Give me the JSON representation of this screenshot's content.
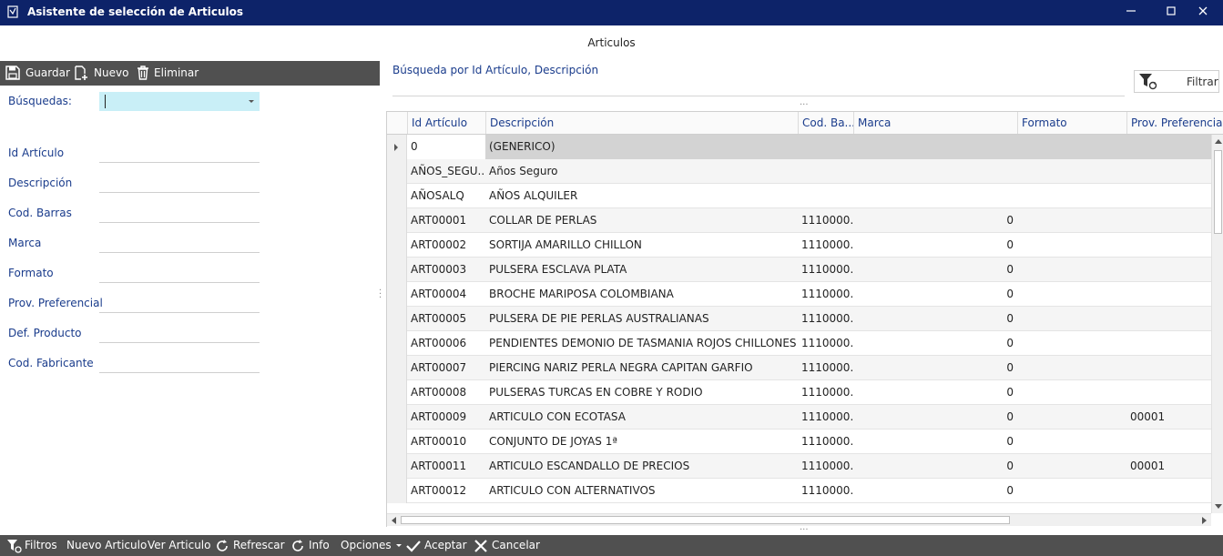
{
  "window": {
    "title": "Asistente de selección de Articulos",
    "app_icon": "app-icon",
    "controls": [
      "minimize-icon",
      "maximize-icon",
      "close-icon"
    ]
  },
  "header": {
    "label": "Articulos"
  },
  "left_toolbar": {
    "guardar": "Guardar",
    "nuevo": "Nuevo",
    "eliminar": "Eliminar"
  },
  "form": {
    "busquedas_label": "Búsquedas:",
    "busquedas_value": "",
    "fields": [
      {
        "label": "Id Artículo",
        "value": ""
      },
      {
        "label": "Descripción",
        "value": ""
      },
      {
        "label": "Cod. Barras",
        "value": ""
      },
      {
        "label": "Marca",
        "value": ""
      },
      {
        "label": "Formato",
        "value": ""
      },
      {
        "label": "Prov. Preferencial",
        "value": ""
      },
      {
        "label": "Def. Producto",
        "value": ""
      },
      {
        "label": "Cod. Fabricante",
        "value": ""
      }
    ]
  },
  "search": {
    "hint": "Búsqueda por Id Artículo, Descripción",
    "filter_button": "Filtrar"
  },
  "grid": {
    "columns": [
      "Id Artículo",
      "Descripción",
      "Cod. Ba...",
      "Marca",
      "Formato",
      "Prov. Preferencial"
    ],
    "rows": [
      {
        "id": "0",
        "desc": "(GENERICO)",
        "barcode": "",
        "marca": "",
        "formato": "",
        "prov": ""
      },
      {
        "id": "AÑOS_SEGU...",
        "desc": "Años Seguro",
        "barcode": "",
        "marca": "",
        "formato": "",
        "prov": ""
      },
      {
        "id": "AÑOSALQ",
        "desc": "AÑOS ALQUILER",
        "barcode": "",
        "marca": "",
        "formato": "",
        "prov": ""
      },
      {
        "id": "ART00001",
        "desc": "COLLAR DE PERLAS",
        "barcode": "1110000...",
        "marca": "0",
        "formato": "",
        "prov": ""
      },
      {
        "id": "ART00002",
        "desc": "SORTIJA AMARILLO CHILLON",
        "barcode": "1110000...",
        "marca": "0",
        "formato": "",
        "prov": ""
      },
      {
        "id": "ART00003",
        "desc": "PULSERA ESCLAVA PLATA",
        "barcode": "1110000...",
        "marca": "0",
        "formato": "",
        "prov": ""
      },
      {
        "id": "ART00004",
        "desc": "BROCHE MARIPOSA COLOMBIANA",
        "barcode": "1110000...",
        "marca": "0",
        "formato": "",
        "prov": ""
      },
      {
        "id": "ART00005",
        "desc": "PULSERA DE PIE PERLAS AUSTRALIANAS",
        "barcode": "1110000...",
        "marca": "0",
        "formato": "",
        "prov": ""
      },
      {
        "id": "ART00006",
        "desc": "PENDIENTES DEMONIO DE TASMANIA ROJOS CHILLONES",
        "barcode": "1110000...",
        "marca": "0",
        "formato": "",
        "prov": ""
      },
      {
        "id": "ART00007",
        "desc": "PIERCING NARIZ PERLA NEGRA CAPITAN GARFIO",
        "barcode": "1110000...",
        "marca": "0",
        "formato": "",
        "prov": ""
      },
      {
        "id": "ART00008",
        "desc": "PULSERAS TURCAS EN COBRE Y RODIO",
        "barcode": "1110000...",
        "marca": "0",
        "formato": "",
        "prov": ""
      },
      {
        "id": "ART00009",
        "desc": "ARTICULO CON ECOTASA",
        "barcode": "1110000...",
        "marca": "0",
        "formato": "",
        "prov": "00001"
      },
      {
        "id": "ART00010",
        "desc": "CONJUNTO DE JOYAS 1ª",
        "barcode": "1110000...",
        "marca": "0",
        "formato": "",
        "prov": ""
      },
      {
        "id": "ART00011",
        "desc": "ARTICULO ESCANDALLO DE PRECIOS",
        "barcode": "1110000...",
        "marca": "0",
        "formato": "",
        "prov": "00001"
      },
      {
        "id": "ART00012",
        "desc": "ARTICULO CON ALTERNATIVOS",
        "barcode": "1110000...",
        "marca": "0",
        "formato": "",
        "prov": ""
      }
    ]
  },
  "bottom_toolbar": {
    "filtros": "Filtros",
    "nuevo_articulo": "Nuevo Articulo",
    "ver_articulo": "Ver Articulo",
    "refrescar": "Refrescar",
    "info": "Info",
    "opciones": "Opciones",
    "aceptar": "Aceptar",
    "cancelar": "Cancelar"
  },
  "colors": {
    "titlebar": "#0d2369",
    "toolbar": "#505050",
    "label_blue": "#1a3c8c",
    "combo_bg": "#c9eff7",
    "selected_row": "#d3d3d3"
  }
}
